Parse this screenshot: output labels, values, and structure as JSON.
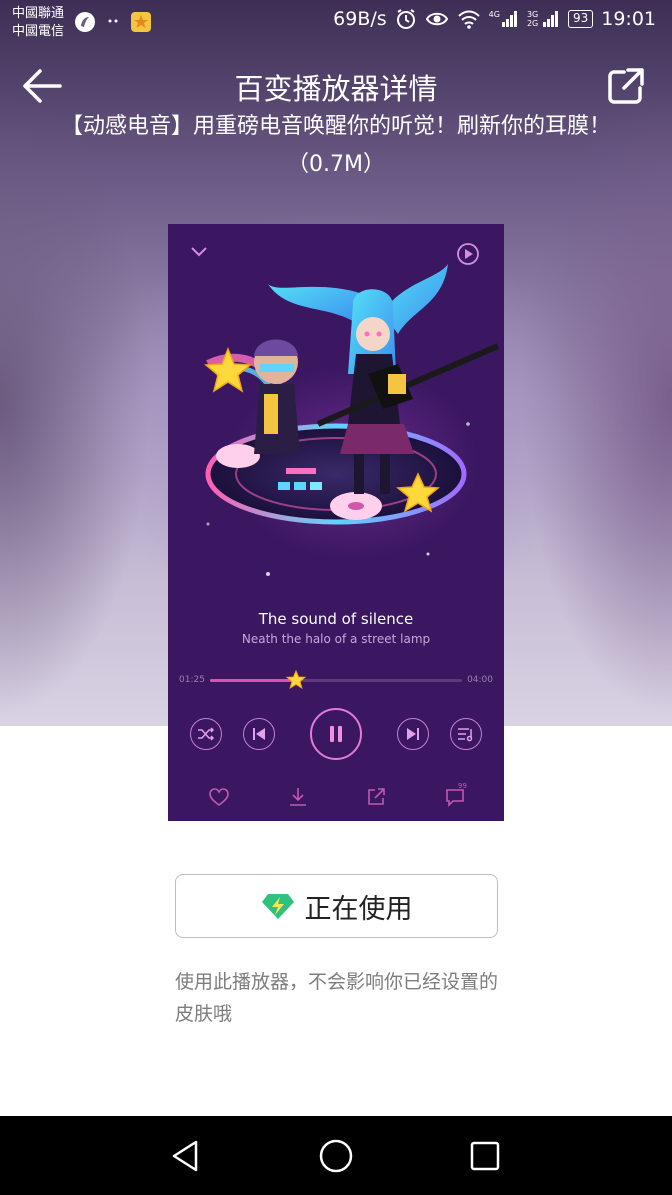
{
  "status_bar": {
    "carrier_line1": "中國聯通",
    "carrier_line2": "中國電信",
    "net_speed": "69B/s",
    "signal1_label": "4G",
    "signal2_label": "3G 2G",
    "battery": "93",
    "time": "19:01",
    "icons": [
      "security-app-icon",
      "dots-icon",
      "qq-space-icon",
      "alarm-icon",
      "eye-icon",
      "wifi-icon",
      "signal-icon",
      "battery-icon"
    ]
  },
  "header": {
    "title": "百变播放器详情",
    "subtitle": "【动感电音】用重磅电音唤醒你的听觉！刷新你的耳膜！（0.7M）",
    "back_icon": "back-arrow-icon",
    "share_icon": "share-icon"
  },
  "preview": {
    "song_title": "The sound of silence",
    "song_lyric": "Neath the halo of a street lamp",
    "time_current": "01:25",
    "time_total": "04:00",
    "progress": 0.34,
    "controls": [
      "shuffle-icon",
      "previous-icon",
      "pause-icon",
      "next-icon",
      "playlist-icon"
    ],
    "bottom_actions": [
      "heart-icon",
      "download-icon",
      "share-icon",
      "comment-icon"
    ],
    "comment_count_badge": "99",
    "accent_color": "#e04fb8",
    "background_color": "#3a1760"
  },
  "action": {
    "use_button_label": "正在使用",
    "use_icon": "green-diamond-lightning-icon",
    "note": "使用此播放器，不会影响你已经设置的皮肤哦"
  },
  "nav_bar": {
    "buttons": [
      "back-triangle-icon",
      "home-circle-icon",
      "recents-square-icon"
    ]
  }
}
